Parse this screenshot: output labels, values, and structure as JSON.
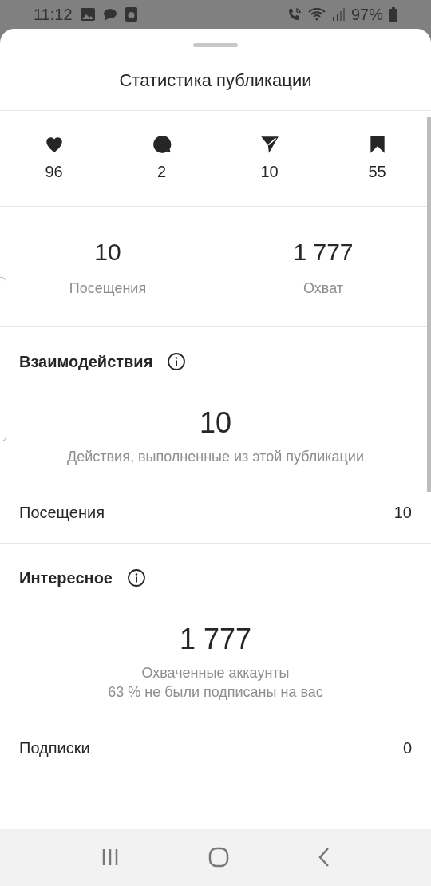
{
  "status_bar": {
    "time": "11:12",
    "battery": "97%"
  },
  "sheet": {
    "title": "Статистика публикации"
  },
  "counters": [
    {
      "kind": "like",
      "value": "96"
    },
    {
      "kind": "comment",
      "value": "2"
    },
    {
      "kind": "share",
      "value": "10"
    },
    {
      "kind": "save",
      "value": "55"
    }
  ],
  "overview": [
    {
      "value": "10",
      "label": "Посещения"
    },
    {
      "value": "1 777",
      "label": "Охват"
    }
  ],
  "sections": [
    {
      "title": "Взаимодействия",
      "value": "10",
      "caption": [
        "Действия, выполненные из этой публикации"
      ],
      "rows": [
        {
          "label": "Посещения",
          "value": "10"
        }
      ]
    },
    {
      "title": "Интересное",
      "value": "1 777",
      "caption": [
        "Охваченные аккаунты",
        "63 % не были подписаны на вас"
      ],
      "rows": [
        {
          "label": "Подписки",
          "value": "0"
        }
      ]
    }
  ]
}
